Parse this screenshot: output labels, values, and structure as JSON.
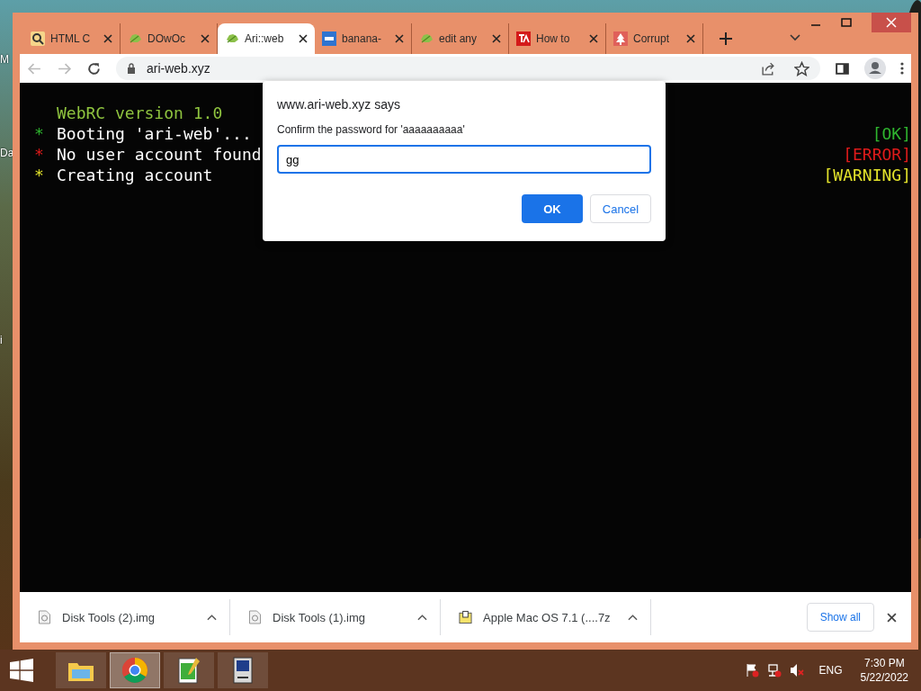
{
  "desktop": {
    "labels": [
      "M",
      "Da",
      "i"
    ]
  },
  "browser": {
    "tabs": [
      {
        "title": "HTML C",
        "kind": "magnifier",
        "selected": false
      },
      {
        "title": "DOwOc",
        "kind": "leaf",
        "selected": false
      },
      {
        "title": "Ari::web",
        "kind": "leaf",
        "selected": true
      },
      {
        "title": "banana-",
        "kind": "gif",
        "selected": false
      },
      {
        "title": "edit any",
        "kind": "leaf",
        "selected": false
      },
      {
        "title": "How to",
        "kind": "ta",
        "selected": false
      },
      {
        "title": "Corrupt",
        "kind": "tree",
        "selected": false
      }
    ],
    "address": "ari-web.xyz"
  },
  "terminal": {
    "lines": [
      {
        "text": "WebRC version 1.0",
        "color": "#8fc43f"
      },
      {
        "text": "Booting 'ari-web'...",
        "color": "#ffffff",
        "marker": {
          "text": "*",
          "color": "#2fb52f"
        },
        "status": {
          "text": "[OK]",
          "color": "#2fb52f"
        }
      },
      {
        "text": "No user account found",
        "color": "#ffffff",
        "marker": {
          "text": "*",
          "color": "#e01b1b"
        },
        "status": {
          "text": "[ERROR]",
          "color": "#e01b1b"
        }
      },
      {
        "text": "Creating account",
        "color": "#ffffff",
        "marker": {
          "text": "*",
          "color": "#e3e32b"
        },
        "status": {
          "text": "[WARNING]",
          "color": "#e3e32b"
        }
      }
    ]
  },
  "dialog": {
    "title": "www.ari-web.xyz says",
    "message": "Confirm the password for 'aaaaaaaaaa'",
    "value": "gg",
    "buttons": [
      {
        "label": "OK",
        "kind": "primary"
      },
      {
        "label": "Cancel",
        "kind": "secondary"
      }
    ]
  },
  "downloads": {
    "items": [
      {
        "name": "Disk Tools (2).img",
        "kind": "disk"
      },
      {
        "name": "Disk Tools (1).img",
        "kind": "disk"
      },
      {
        "name": "Apple Mac OS 7.1 (....7z",
        "kind": "archive"
      }
    ],
    "show_all": "Show all"
  },
  "taskbar": {
    "apps": [
      {
        "kind": "folder",
        "selected": false
      },
      {
        "kind": "chrome",
        "selected": true
      },
      {
        "kind": "notepad",
        "selected": false
      },
      {
        "kind": "mac",
        "selected": false
      }
    ],
    "language": "ENG",
    "time": "7:30 PM",
    "date": "5/22/2022"
  }
}
